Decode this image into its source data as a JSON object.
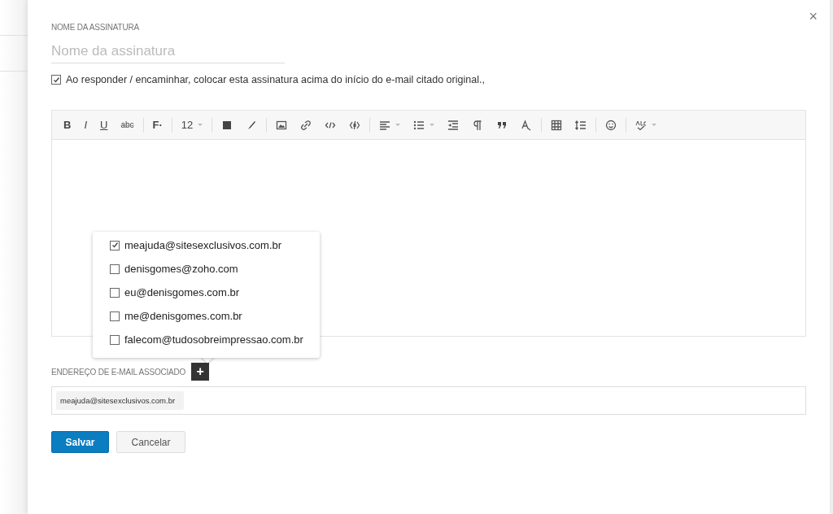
{
  "signature_name": {
    "label": "NOME DA ASSINATURA",
    "placeholder": "Nome da assinatura"
  },
  "place_above": {
    "label": "Ao responder / encaminhar, colocar esta assinatura acima do início do e-mail citado original.,",
    "checked": true
  },
  "editor": {
    "toolbar": [
      {
        "kind": "text",
        "label": "B"
      },
      {
        "kind": "text",
        "label": "I"
      },
      {
        "kind": "text",
        "label": "U"
      },
      {
        "kind": "text",
        "label": "abc"
      },
      {
        "kind": "separator"
      },
      {
        "kind": "text",
        "label": "F·"
      },
      {
        "kind": "separator"
      },
      {
        "kind": "text",
        "label": "12",
        "dropdown": true
      },
      {
        "kind": "separator"
      },
      {
        "kind": "icon"
      },
      {
        "kind": "icon"
      },
      {
        "kind": "separator"
      },
      {
        "kind": "icon"
      },
      {
        "kind": "icon"
      },
      {
        "kind": "icon"
      },
      {
        "kind": "icon"
      },
      {
        "kind": "separator"
      },
      {
        "kind": "icon",
        "dropdown": true
      },
      {
        "kind": "icon",
        "dropdown": true
      },
      {
        "kind": "icon"
      },
      {
        "kind": "icon"
      },
      {
        "kind": "icon"
      },
      {
        "kind": "icon"
      },
      {
        "kind": "separator"
      },
      {
        "kind": "icon"
      },
      {
        "kind": "icon"
      },
      {
        "kind": "separator"
      },
      {
        "kind": "icon"
      },
      {
        "kind": "separator"
      },
      {
        "kind": "icon",
        "dropdown": true
      }
    ]
  },
  "address_menu": [
    {
      "email": "meajuda@sitesexclusivos.com.br",
      "checked": true
    },
    {
      "email": "denisgomes@zoho.com",
      "checked": false
    },
    {
      "email": "eu@denisgomes.com.br",
      "checked": false
    },
    {
      "email": "me@denisgomes.com.br",
      "checked": false
    },
    {
      "email": "falecom@tudosobreimpressao.com.br",
      "checked": false
    }
  ],
  "associated_email": {
    "label": "ENDEREÇO DE E-MAIL ASSOCIADO",
    "add_button": "+",
    "chips": [
      "meajuda@sitesexclusivos.com.br"
    ]
  },
  "buttons": [
    {
      "label": "Salvar",
      "kind": "primary"
    },
    {
      "label": "Cancelar",
      "kind": "secondary"
    }
  ],
  "close": "×"
}
